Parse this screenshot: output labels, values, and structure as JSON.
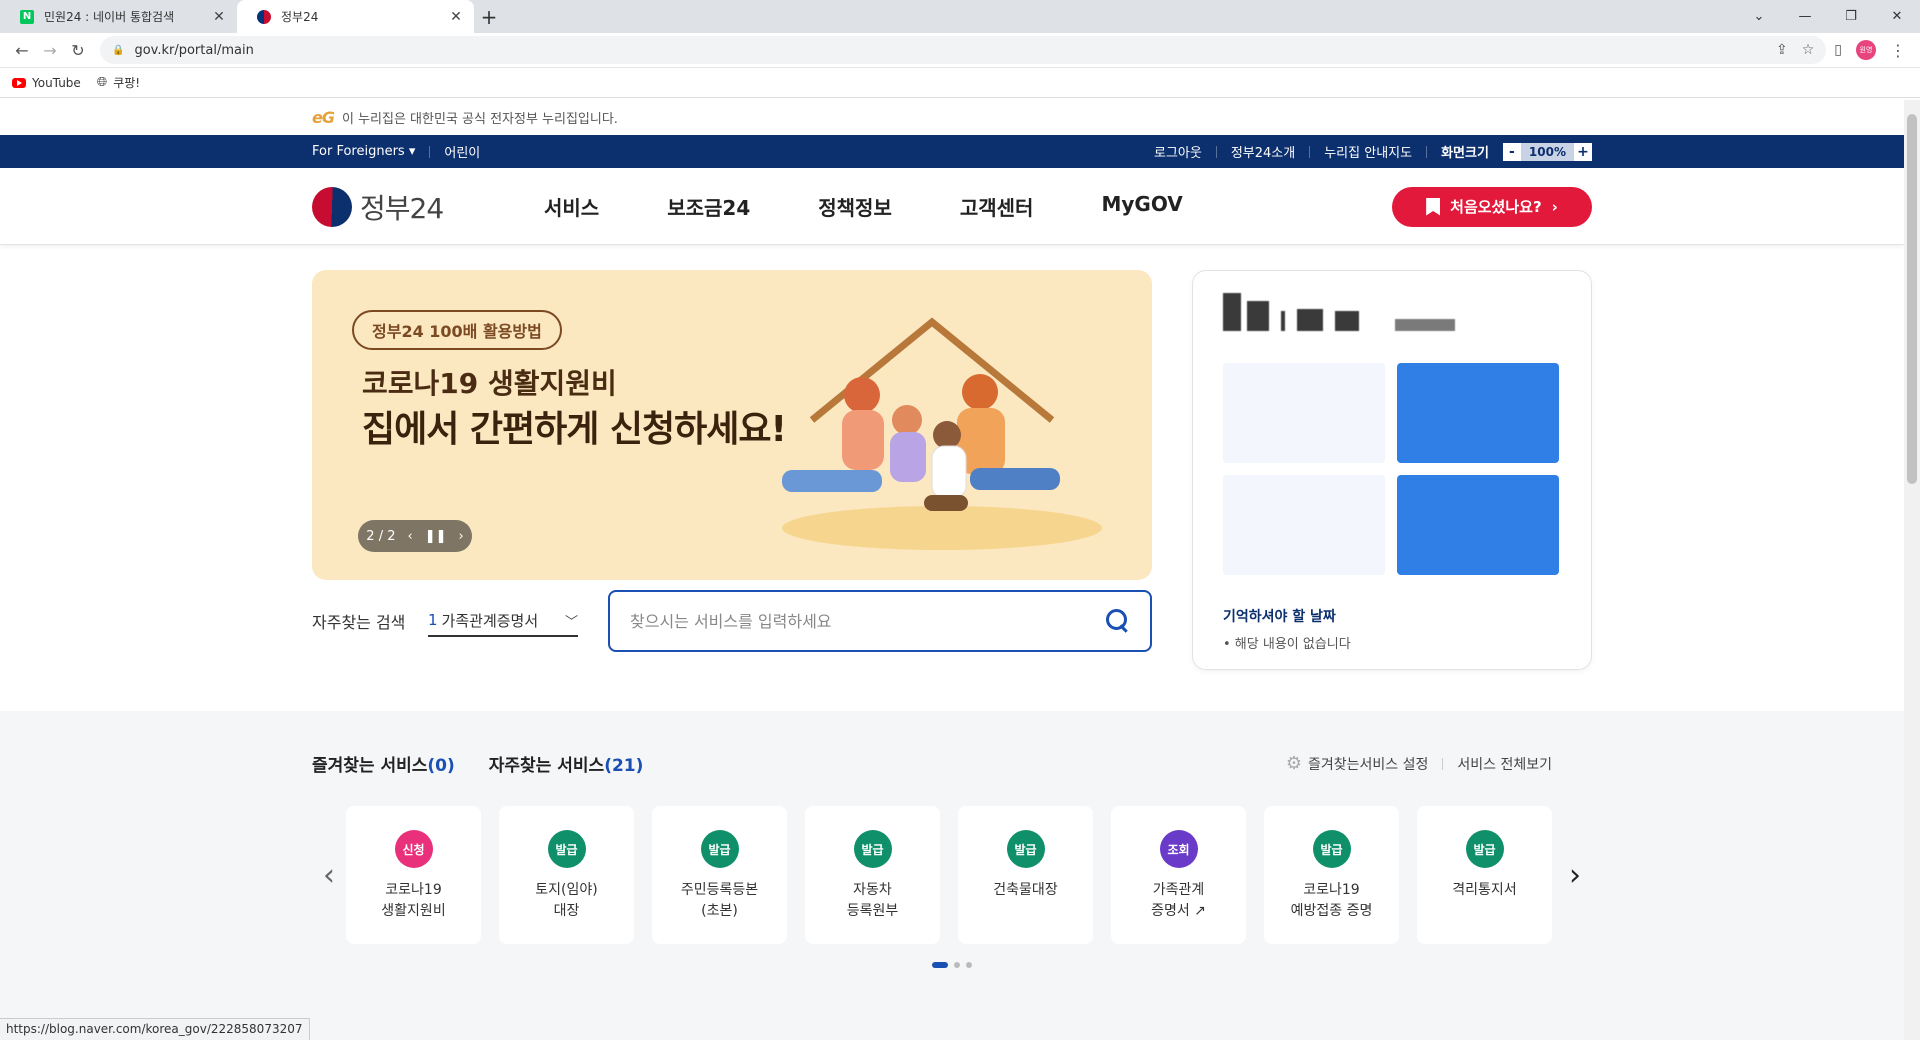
{
  "browser": {
    "tabs": [
      {
        "title": "민원24 : 네이버 통합검색",
        "favicon": "naver-icon",
        "active": false
      },
      {
        "title": "정부24",
        "favicon": "gov-icon",
        "active": true
      }
    ],
    "url": "gov.kr/portal/main",
    "profile_label": "원영",
    "bookmarks": [
      {
        "label": "YouTube",
        "icon": "youtube-icon"
      },
      {
        "label": "쿠팡!",
        "icon": "globe-icon"
      }
    ],
    "status_url": "https://blog.naver.com/korea_gov/222858073207"
  },
  "site": {
    "official_notice": "이 누리집은 대한민국 공식 전자정부 누리집입니다.",
    "eg_mark": "eG",
    "util": {
      "foreigners": "For Foreigners",
      "kids": "어린이",
      "logout": "로그아웃",
      "about": "정부24소개",
      "sitemap": "누리집 안내지도",
      "zoom_label": "화면크기",
      "zoom_minus": "-",
      "zoom_value": "100%",
      "zoom_plus": "+"
    },
    "logo_text": "정부24",
    "menu": [
      "서비스",
      "보조금24",
      "정책정보",
      "고객센터",
      "MyGOV"
    ],
    "first_visit": "처음오셨나요?",
    "banner": {
      "pill": "정부24 100배 활용방법",
      "line1": "코로나19 생활지원비",
      "line2": "집에서 간편하게 신청하세요!",
      "page_indicator": "2 / 2"
    },
    "card": {
      "subtitle": "기억하셔야 할 날짜",
      "note": "• 해당 내용이 없습니다"
    },
    "search": {
      "label": "자주찾는 검색",
      "selected_num": "1",
      "selected_text": "가족관계증명서",
      "placeholder": "찾으시는 서비스를 입력하세요"
    },
    "services": {
      "tab_fav": "즐겨찾는 서비스",
      "tab_fav_count": "(0)",
      "tab_freq": "자주찾는 서비스",
      "tab_freq_count": "(21)",
      "settings": "즐겨찾는서비스 설정",
      "view_all": "서비스 전체보기",
      "items": [
        {
          "badge": "신청",
          "color": "#e8317a",
          "name": "코로나19\n생활지원비"
        },
        {
          "badge": "발급",
          "color": "#10906a",
          "name": "토지(임야)\n대장"
        },
        {
          "badge": "발급",
          "color": "#10906a",
          "name": "주민등록등본\n(초본)"
        },
        {
          "badge": "발급",
          "color": "#10906a",
          "name": "자동차\n등록원부"
        },
        {
          "badge": "발급",
          "color": "#10906a",
          "name": "건축물대장"
        },
        {
          "badge": "조회",
          "color": "#6a3bc9",
          "name": "가족관계\n증명서 ↗"
        },
        {
          "badge": "발급",
          "color": "#10906a",
          "name": "코로나19\n예방접종 증명"
        },
        {
          "badge": "발급",
          "color": "#10906a",
          "name": "격리통지서"
        }
      ]
    }
  }
}
